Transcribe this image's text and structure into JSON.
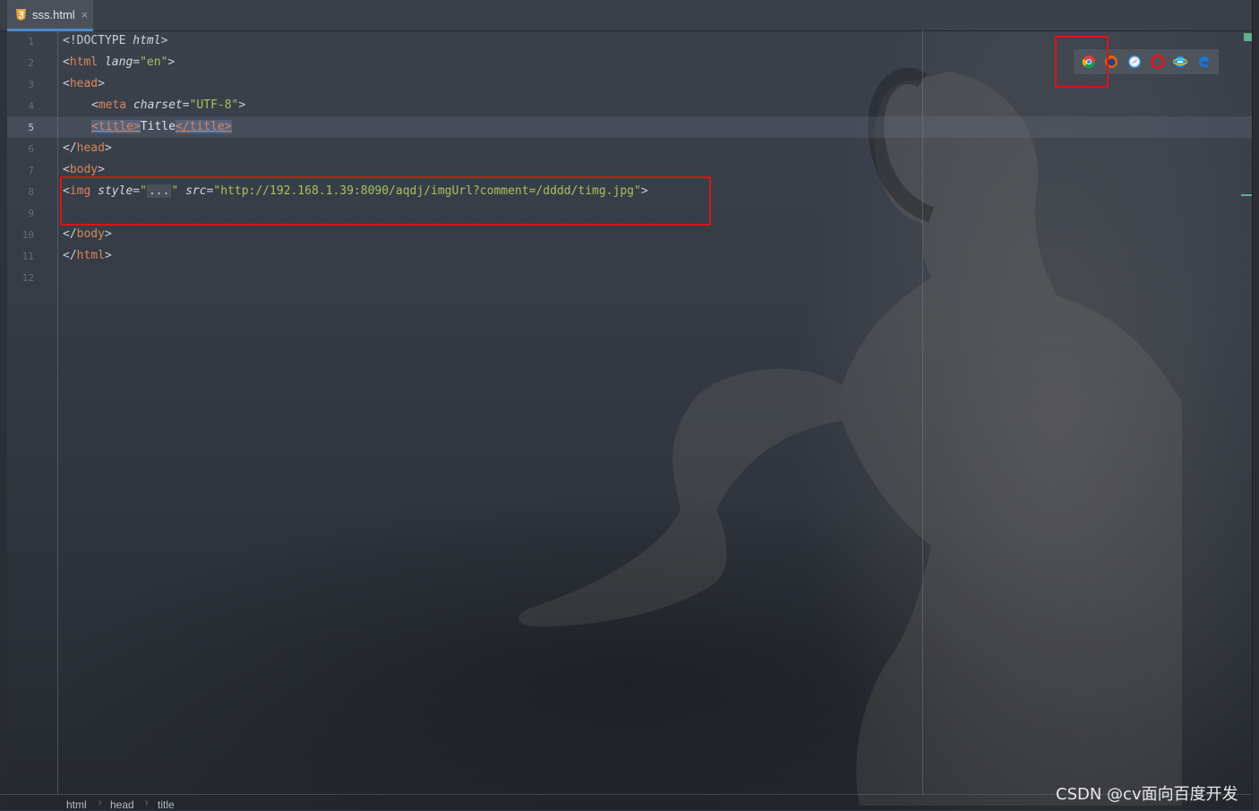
{
  "tab": {
    "filename": "sss.html",
    "close": "×"
  },
  "line_numbers": [
    "1",
    "2",
    "3",
    "4",
    "5",
    "6",
    "7",
    "8",
    "9",
    "10",
    "11",
    "12"
  ],
  "current_line": "5",
  "code": {
    "l1_a": "<!DOCTYPE ",
    "l1_b": "html",
    "l1_c": ">",
    "l2_a": "<",
    "l2_tag": "html",
    "l2_attr": " lang",
    "l2_eq": "=",
    "l2_val": "\"en\"",
    "l2_end": ">",
    "l3_a": "<",
    "l3_tag": "head",
    "l3_end": ">",
    "l4_a": "<",
    "l4_tag": "meta",
    "l4_attr": " charset",
    "l4_eq": "=",
    "l4_val": "\"UTF-8\"",
    "l4_end": ">",
    "l5_open": "<title>",
    "l5_text": "Title",
    "l5_close": "</title>",
    "l6_a": "</",
    "l6_tag": "head",
    "l6_end": ">",
    "l7_a": "<",
    "l7_tag": "body",
    "l7_end": ">",
    "l8_a": "<",
    "l8_tag": "img",
    "l8_attr1": " style",
    "l8_eq1": "=",
    "l8_q1": "\"",
    "l8_fold": "...",
    "l8_q2": "\"",
    "l8_attr2": " src",
    "l8_eq2": "=",
    "l8_val2": "\"http://192.168.1.39:8090/aqdj/imgUrl?comment=/dddd/timg.jpg\"",
    "l8_end": ">",
    "l10_a": "</",
    "l10_tag": "body",
    "l10_end": ">",
    "l11_a": "</",
    "l11_tag": "html",
    "l11_end": ">"
  },
  "browser_icons": [
    "chrome-icon",
    "firefox-icon",
    "safari-icon",
    "opera-icon",
    "ie-icon",
    "edge-icon"
  ],
  "breadcrumb": [
    "html",
    "head",
    "title"
  ],
  "breadcrumb_sep": "›",
  "watermark": "CSDN @cv面向百度开发",
  "colors": {
    "tag": "#e8bf6a",
    "string": "#a5c261",
    "accent": "#4a88c7",
    "annotation_box": "#d01818"
  }
}
